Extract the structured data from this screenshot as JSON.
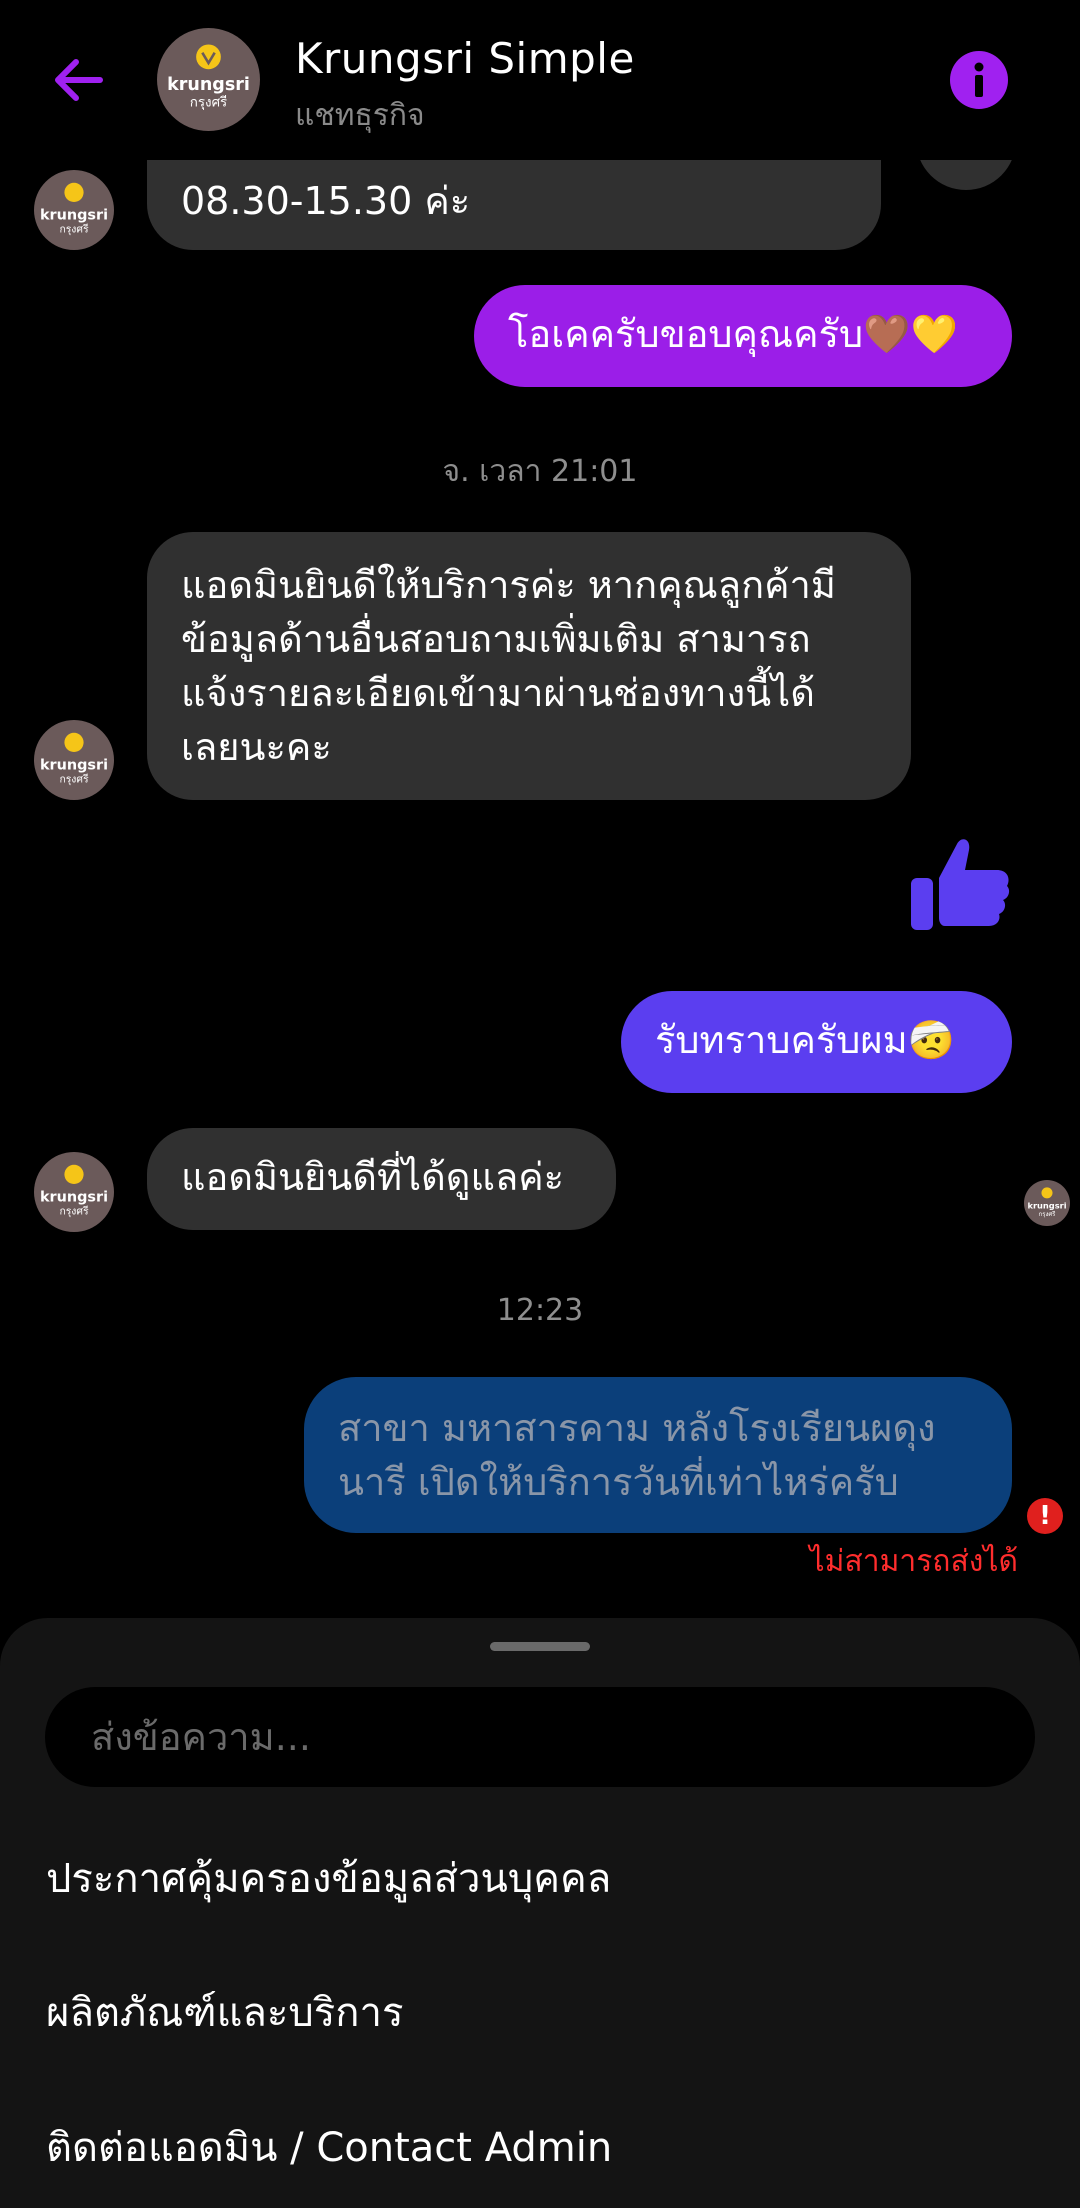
{
  "header": {
    "title": "Krungsri Simple",
    "subtitle": "แชทธุรกิจ"
  },
  "colors": {
    "accent_purple": "#a021f0",
    "bubble_out_1": "#9b1ee8",
    "bubble_out_2": "#5b3ef0",
    "bubble_failed": "#0b3f7a",
    "bubble_in": "#303030",
    "error_red": "#ff2d2d"
  },
  "avatar": {
    "brand": "krungsri",
    "brand_thai": "กรุงศรี"
  },
  "messages": {
    "m1_line1": "08.30-15.30 ค่ะ",
    "m2": "โอเคครับขอบคุณครับ🤎💛",
    "ts1": "จ. เวลา 21:01",
    "m3_line1": "แอดมินยินดีให้บริการค่ะ หากคุณลูกค้ามี",
    "m3_line2": "ข้อมูลด้านอื่นสอบถามเพิ่มเติม สามารถ",
    "m3_line3": "แจ้งรายละเอียดเข้ามาผ่านช่องทางนี้ได้",
    "m3_line4": "เลยนะคะ",
    "m5": "รับทราบครับผม🤕",
    "m6": "แอดมินยินดีที่ได้ดูแลค่ะ",
    "ts2": "12:23",
    "m7_line1": "สาขา มหาสารคาม หลังโรงเรียนผดุง",
    "m7_line2": "นารี เปิดให้บริการวันที่เท่าไหร่ครับ",
    "error_icon": "!",
    "error_text": "ไม่สามารถส่งได้"
  },
  "composer": {
    "placeholder": "ส่งข้อความ..."
  },
  "menu": [
    "ประกาศคุ้มครองข้อมูลส่วนบุคคล",
    "ผลิตภัณฑ์และบริการ",
    "ติดต่อแอดมิน / Contact Admin"
  ]
}
